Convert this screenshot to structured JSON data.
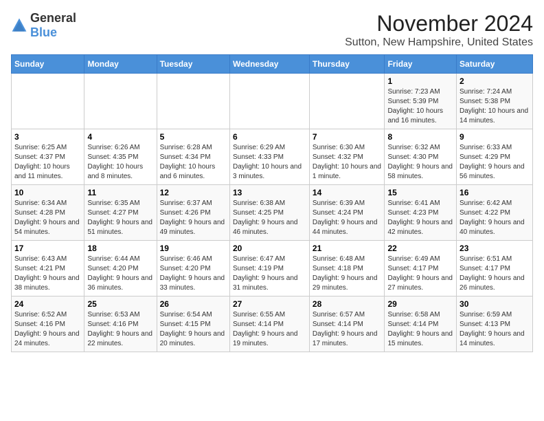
{
  "logo": {
    "general": "General",
    "blue": "Blue"
  },
  "header": {
    "title": "November 2024",
    "subtitle": "Sutton, New Hampshire, United States"
  },
  "weekdays": [
    "Sunday",
    "Monday",
    "Tuesday",
    "Wednesday",
    "Thursday",
    "Friday",
    "Saturday"
  ],
  "weeks": [
    [
      {
        "day": "",
        "info": ""
      },
      {
        "day": "",
        "info": ""
      },
      {
        "day": "",
        "info": ""
      },
      {
        "day": "",
        "info": ""
      },
      {
        "day": "",
        "info": ""
      },
      {
        "day": "1",
        "info": "Sunrise: 7:23 AM\nSunset: 5:39 PM\nDaylight: 10 hours and 16 minutes."
      },
      {
        "day": "2",
        "info": "Sunrise: 7:24 AM\nSunset: 5:38 PM\nDaylight: 10 hours and 14 minutes."
      }
    ],
    [
      {
        "day": "3",
        "info": "Sunrise: 6:25 AM\nSunset: 4:37 PM\nDaylight: 10 hours and 11 minutes."
      },
      {
        "day": "4",
        "info": "Sunrise: 6:26 AM\nSunset: 4:35 PM\nDaylight: 10 hours and 8 minutes."
      },
      {
        "day": "5",
        "info": "Sunrise: 6:28 AM\nSunset: 4:34 PM\nDaylight: 10 hours and 6 minutes."
      },
      {
        "day": "6",
        "info": "Sunrise: 6:29 AM\nSunset: 4:33 PM\nDaylight: 10 hours and 3 minutes."
      },
      {
        "day": "7",
        "info": "Sunrise: 6:30 AM\nSunset: 4:32 PM\nDaylight: 10 hours and 1 minute."
      },
      {
        "day": "8",
        "info": "Sunrise: 6:32 AM\nSunset: 4:30 PM\nDaylight: 9 hours and 58 minutes."
      },
      {
        "day": "9",
        "info": "Sunrise: 6:33 AM\nSunset: 4:29 PM\nDaylight: 9 hours and 56 minutes."
      }
    ],
    [
      {
        "day": "10",
        "info": "Sunrise: 6:34 AM\nSunset: 4:28 PM\nDaylight: 9 hours and 54 minutes."
      },
      {
        "day": "11",
        "info": "Sunrise: 6:35 AM\nSunset: 4:27 PM\nDaylight: 9 hours and 51 minutes."
      },
      {
        "day": "12",
        "info": "Sunrise: 6:37 AM\nSunset: 4:26 PM\nDaylight: 9 hours and 49 minutes."
      },
      {
        "day": "13",
        "info": "Sunrise: 6:38 AM\nSunset: 4:25 PM\nDaylight: 9 hours and 46 minutes."
      },
      {
        "day": "14",
        "info": "Sunrise: 6:39 AM\nSunset: 4:24 PM\nDaylight: 9 hours and 44 minutes."
      },
      {
        "day": "15",
        "info": "Sunrise: 6:41 AM\nSunset: 4:23 PM\nDaylight: 9 hours and 42 minutes."
      },
      {
        "day": "16",
        "info": "Sunrise: 6:42 AM\nSunset: 4:22 PM\nDaylight: 9 hours and 40 minutes."
      }
    ],
    [
      {
        "day": "17",
        "info": "Sunrise: 6:43 AM\nSunset: 4:21 PM\nDaylight: 9 hours and 38 minutes."
      },
      {
        "day": "18",
        "info": "Sunrise: 6:44 AM\nSunset: 4:20 PM\nDaylight: 9 hours and 36 minutes."
      },
      {
        "day": "19",
        "info": "Sunrise: 6:46 AM\nSunset: 4:20 PM\nDaylight: 9 hours and 33 minutes."
      },
      {
        "day": "20",
        "info": "Sunrise: 6:47 AM\nSunset: 4:19 PM\nDaylight: 9 hours and 31 minutes."
      },
      {
        "day": "21",
        "info": "Sunrise: 6:48 AM\nSunset: 4:18 PM\nDaylight: 9 hours and 29 minutes."
      },
      {
        "day": "22",
        "info": "Sunrise: 6:49 AM\nSunset: 4:17 PM\nDaylight: 9 hours and 27 minutes."
      },
      {
        "day": "23",
        "info": "Sunrise: 6:51 AM\nSunset: 4:17 PM\nDaylight: 9 hours and 26 minutes."
      }
    ],
    [
      {
        "day": "24",
        "info": "Sunrise: 6:52 AM\nSunset: 4:16 PM\nDaylight: 9 hours and 24 minutes."
      },
      {
        "day": "25",
        "info": "Sunrise: 6:53 AM\nSunset: 4:16 PM\nDaylight: 9 hours and 22 minutes."
      },
      {
        "day": "26",
        "info": "Sunrise: 6:54 AM\nSunset: 4:15 PM\nDaylight: 9 hours and 20 minutes."
      },
      {
        "day": "27",
        "info": "Sunrise: 6:55 AM\nSunset: 4:14 PM\nDaylight: 9 hours and 19 minutes."
      },
      {
        "day": "28",
        "info": "Sunrise: 6:57 AM\nSunset: 4:14 PM\nDaylight: 9 hours and 17 minutes."
      },
      {
        "day": "29",
        "info": "Sunrise: 6:58 AM\nSunset: 4:14 PM\nDaylight: 9 hours and 15 minutes."
      },
      {
        "day": "30",
        "info": "Sunrise: 6:59 AM\nSunset: 4:13 PM\nDaylight: 9 hours and 14 minutes."
      }
    ]
  ]
}
